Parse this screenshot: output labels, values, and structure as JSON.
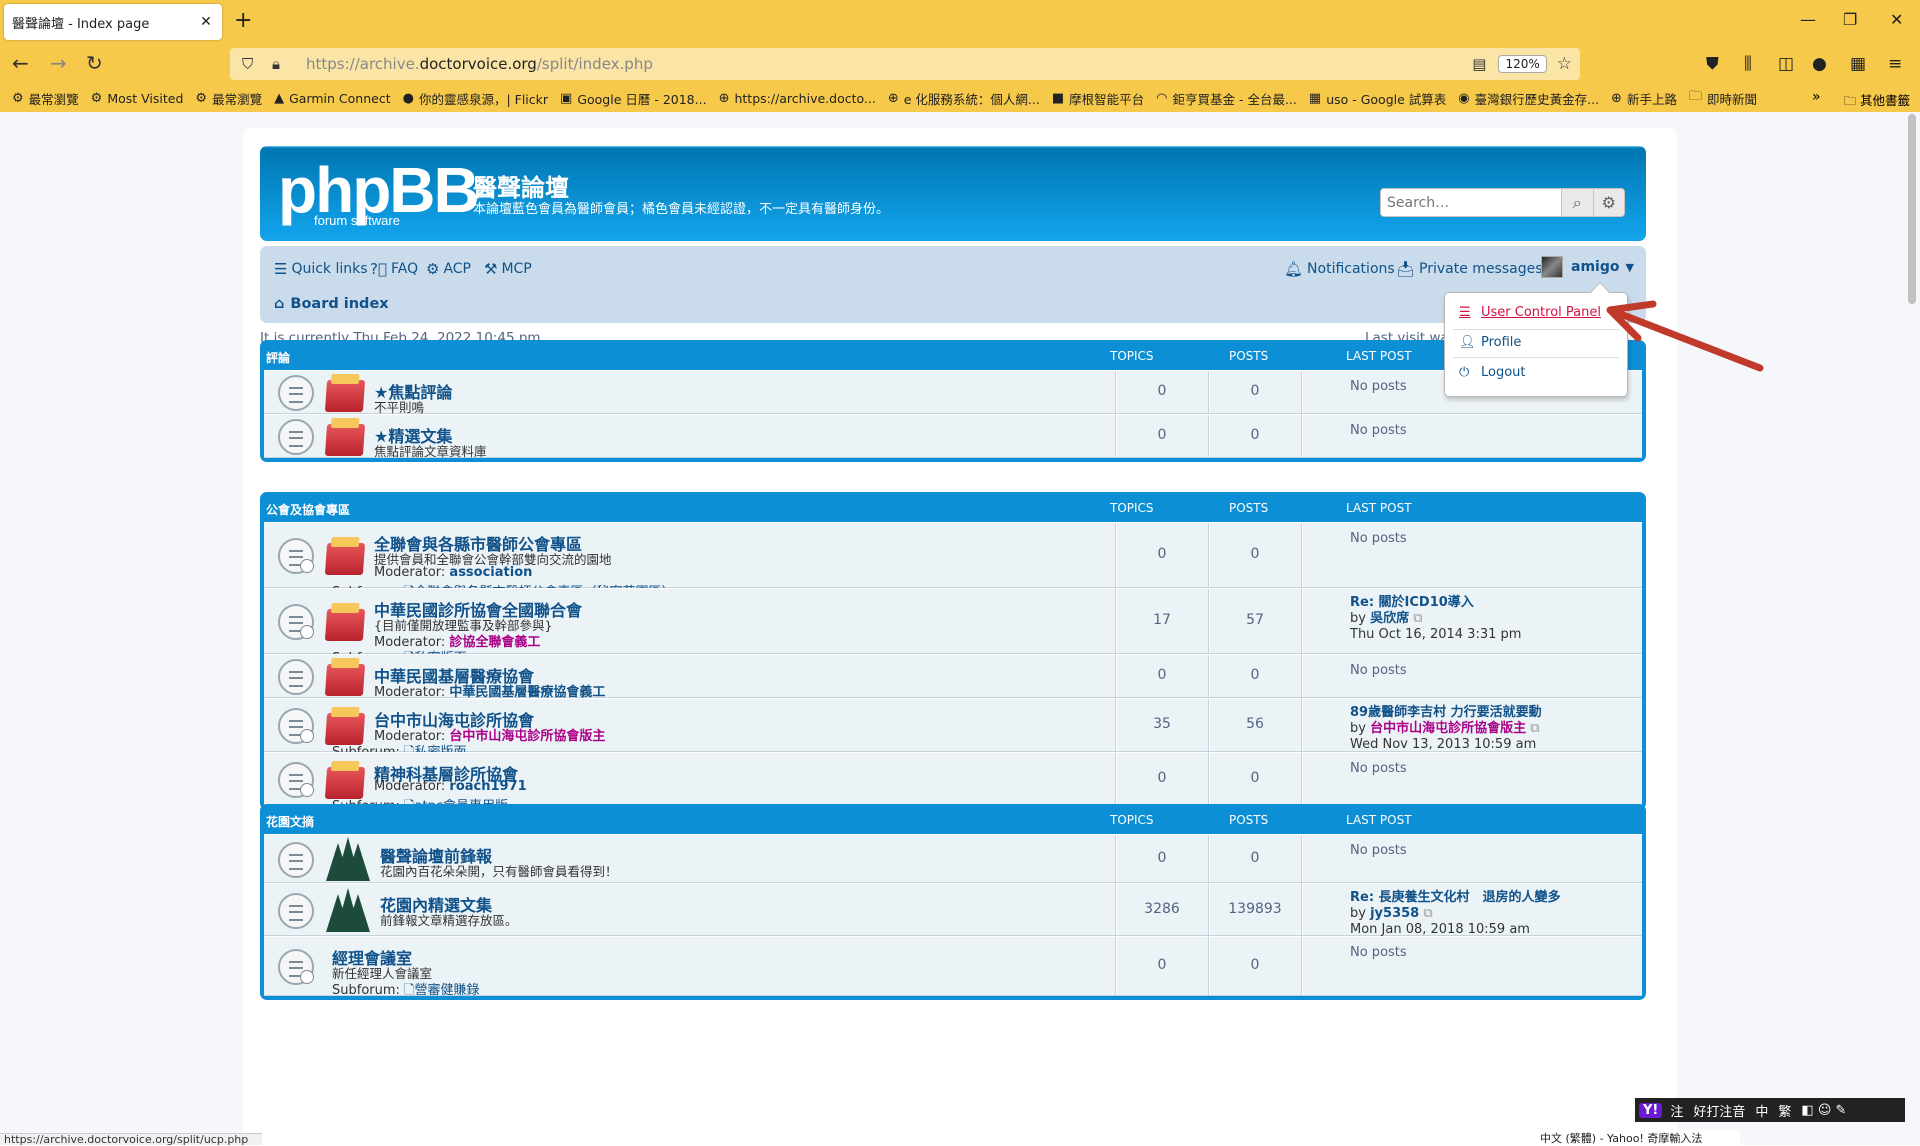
{
  "browser": {
    "tab_title": "醫聲論壇 - Index page",
    "url_prefix": "https://archive.",
    "url_domain": "doctorvoice.org",
    "url_path": "/split/index.php",
    "zoom": "120%",
    "bookmarks": [
      {
        "icon": "gear-icon",
        "label": "最常瀏覽"
      },
      {
        "icon": "gear-icon",
        "label": "Most Visited"
      },
      {
        "icon": "gear-icon",
        "label": "最常瀏覽"
      },
      {
        "icon": "garmin-icon",
        "label": "Garmin Connect"
      },
      {
        "icon": "flickr-icon",
        "label": "你的靈感泉源，| Flickr"
      },
      {
        "icon": "calendar-icon",
        "label": "Google 日曆 - 2018..."
      },
      {
        "icon": "globe-icon",
        "label": "https://archive.docto..."
      },
      {
        "icon": "globe-icon",
        "label": "e 化服務系統：個人網..."
      },
      {
        "icon": "jpm-icon",
        "label": "摩根智能平台"
      },
      {
        "icon": "rainbow-icon",
        "label": "鉅亨買基金 - 全台最..."
      },
      {
        "icon": "sheets-icon",
        "label": "uso - Google 試算表"
      },
      {
        "icon": "bank-icon",
        "label": "臺灣銀行歷史黃金存..."
      },
      {
        "icon": "globe-icon",
        "label": "新手上路"
      },
      {
        "icon": "folder-icon",
        "label": "即時新聞"
      }
    ],
    "bookmarks_other": "其他書籤",
    "status_url": "https://archive.doctorvoice.org/split/ucp.php"
  },
  "site": {
    "logo_text": "phpBB",
    "logo_sub": "forum    software",
    "name": "醫聲論壇",
    "description": "本論壇藍色會員為醫師會員；橘色會員未經認證，不一定具有醫師身份。",
    "search_placeholder": "Search…"
  },
  "nav": {
    "quick_links": "Quick links",
    "faq": "FAQ",
    "acp": "ACP",
    "mcp": "MCP",
    "notifications": "Notifications",
    "private_messages": "Private messages",
    "username": "amigo",
    "board_index": "Board index"
  },
  "info": {
    "current_time": "It is currently Thu Feb 24, 2022 10:45 pm",
    "last_visit": "Last visit wa",
    "mark_read": "ad"
  },
  "dropdown": {
    "ucp": "User Control Panel",
    "profile": "Profile",
    "logout": "Logout"
  },
  "col": {
    "topics": "TOPICS",
    "posts": "POSTS",
    "last_post": "LAST POST"
  },
  "categories": [
    {
      "title": "評論",
      "forums": [
        {
          "title": "★焦點評論",
          "desc": "不平則鳴",
          "topics": "0",
          "posts": "0",
          "last": "No posts"
        },
        {
          "title": "★精選文集",
          "desc": "焦點評論文章資料庫",
          "topics": "0",
          "posts": "0",
          "last": "No posts"
        }
      ]
    },
    {
      "title": "公會及協會專區",
      "forums": [
        {
          "title": "全聯會與各縣市醫師公會專區",
          "desc": "提供會員和全聯會公會幹部雙向交流的園地",
          "mod_label": "Moderator:",
          "mod": "association",
          "sub_label": "Subforum:",
          "sub": "全聯會與各縣市醫師公會專區（秘密花園區）",
          "topics": "0",
          "posts": "0",
          "last": "No posts"
        },
        {
          "title": "中華民國診所協會全國聯合會",
          "desc": "{目前僅開放理監事及幹部參與}",
          "mod_label": "Moderator:",
          "mod": "診協全聯會義工",
          "sub_label": "Subforum:",
          "sub": "私密版面",
          "topics": "17",
          "posts": "57",
          "last_title": "Re: 關於ICD10導入",
          "last_by_label": "by",
          "last_by": "吳欣席",
          "last_date": "Thu Oct 16, 2014 3:31 pm"
        },
        {
          "title": "中華民國基層醫療協會",
          "mod_label": "Moderator:",
          "mod": "中華民國基層醫療協會義工",
          "topics": "0",
          "posts": "0",
          "last": "No posts"
        },
        {
          "title": "台中市山海屯診所協會",
          "mod_label": "Moderator:",
          "mod": "台中市山海屯診所協會版主",
          "sub_label": "Subforum:",
          "sub": "私密版面",
          "topics": "35",
          "posts": "56",
          "last_title": "89歲醫師李吉村 力行要活就要動",
          "last_by_label": "by",
          "last_by": "台中市山海屯診所協會版主",
          "last_date": "Wed Nov 13, 2013 10:59 am"
        },
        {
          "title": "精神科基層診所協會",
          "mod_label": "Moderator:",
          "mod": "roach1971",
          "sub_label": "Subforum:",
          "sub": "atpc會員專用版",
          "topics": "0",
          "posts": "0",
          "last": "No posts"
        }
      ]
    },
    {
      "title": "花園文摘",
      "forums": [
        {
          "title": "醫聲論壇前鋒報",
          "desc": "花園內百花朵朵開，只有醫師會員看得到！",
          "topics": "0",
          "posts": "0",
          "last": "No posts"
        },
        {
          "title": "花園內精選文集",
          "desc": "前鋒報文章精選存放區。",
          "topics": "3286",
          "posts": "139893",
          "last_title": "Re: 長庚養生文化村　退房的人變多",
          "last_by_label": "by",
          "last_by": "jy5358",
          "last_date": "Mon Jan 08, 2018 10:59 am"
        },
        {
          "title": "經理會議室",
          "desc": "新任經理人會議室",
          "sub_label": "Subforum:",
          "sub": "營審健賺錄",
          "topics": "0",
          "posts": "0",
          "last": "No posts"
        }
      ]
    }
  ],
  "ime": {
    "badge": "Y!",
    "items": [
      "注",
      "好打注音",
      "中",
      "繁"
    ],
    "footer": "中文 (繁體) - Yahoo! 奇摩輸入法"
  }
}
